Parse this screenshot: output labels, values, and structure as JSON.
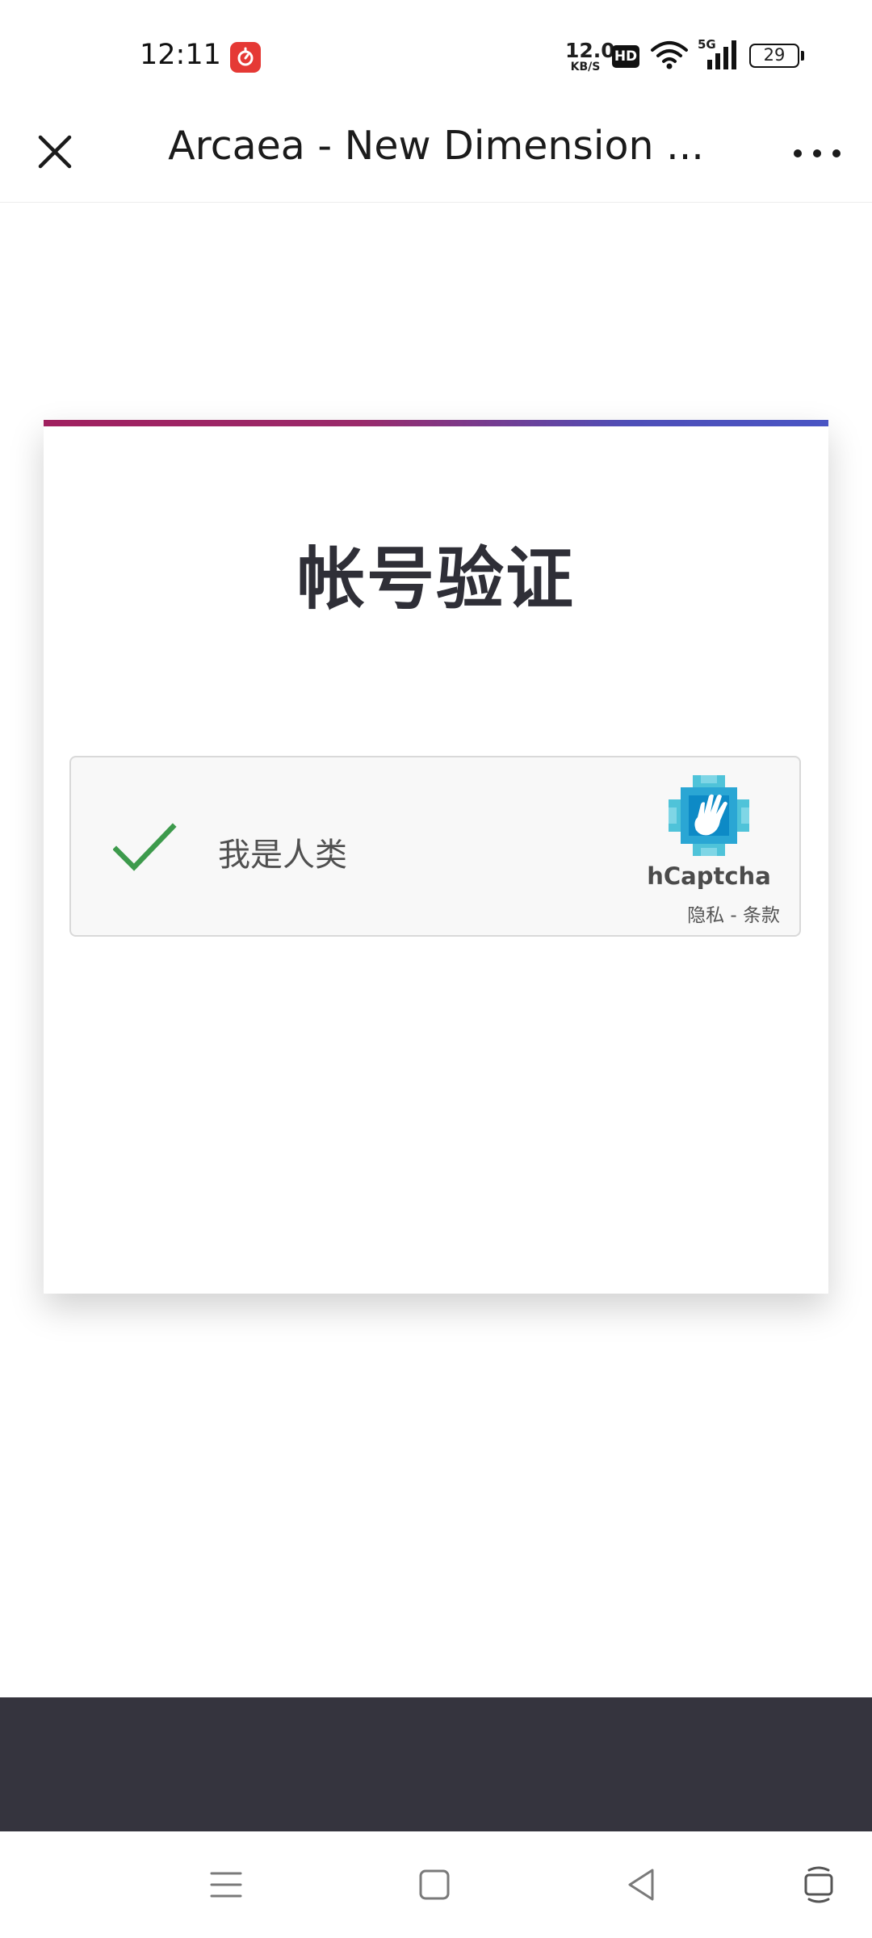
{
  "status_bar": {
    "time": "12:11",
    "speed_value": "12.0",
    "speed_unit": "KB/S",
    "hd_label": "HD",
    "signal_label": "5G",
    "battery": "29"
  },
  "title_bar": {
    "title": "Arcaea - New Dimension ..."
  },
  "card": {
    "title": "帐号验证",
    "accent_colors": [
      "#a0205f",
      "#4a55c4"
    ]
  },
  "captcha": {
    "label": "我是人类",
    "brand": "hCaptcha",
    "privacy_link": "隐私",
    "separator": " - ",
    "terms_link": "条款",
    "check_color": "#3d9a4c"
  },
  "nav_bar": {
    "icons": [
      "menu-icon",
      "home-icon",
      "back-icon",
      "screen-rotate-icon"
    ]
  }
}
